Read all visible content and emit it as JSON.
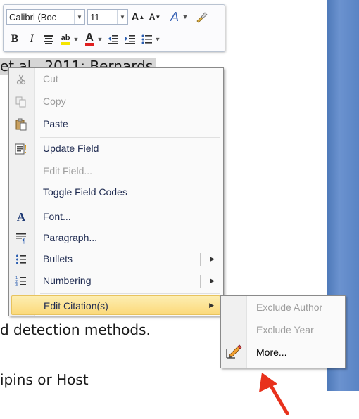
{
  "document": {
    "lines": [
      "...",
      "et al., 2011; Bernards",
      "d detection methods.",
      "ipins or Host"
    ]
  },
  "mini_toolbar": {
    "font_name": "Calibri (Boc",
    "font_size": "11",
    "bold": "B",
    "italic": "I",
    "grow_font": "A",
    "shrink_font": "A",
    "styles": "A",
    "font_color": "A",
    "highlight": "ab"
  },
  "context_menu": {
    "items": [
      {
        "label": "Cut",
        "enabled": false
      },
      {
        "label": "Copy",
        "enabled": false
      },
      {
        "label": "Paste",
        "enabled": true
      },
      {
        "label": "Update Field",
        "enabled": true
      },
      {
        "label": "Edit Field...",
        "enabled": false
      },
      {
        "label": "Toggle Field Codes",
        "enabled": true
      },
      {
        "label": "Font...",
        "enabled": true
      },
      {
        "label": "Paragraph...",
        "enabled": true
      },
      {
        "label": "Bullets",
        "enabled": true
      },
      {
        "label": "Numbering",
        "enabled": true
      },
      {
        "label": "Edit Citation(s)",
        "enabled": true
      }
    ]
  },
  "submenu": {
    "items": [
      {
        "label": "Exclude Author",
        "enabled": false
      },
      {
        "label": "Exclude Year",
        "enabled": false
      },
      {
        "label": "More...",
        "enabled": true
      }
    ]
  },
  "colors": {
    "highlight_bg": "#fbd97a",
    "disabled_text": "#9d9d9d",
    "arrow_red": "#e8311c",
    "side_bar_blue": "#5a84c4"
  }
}
